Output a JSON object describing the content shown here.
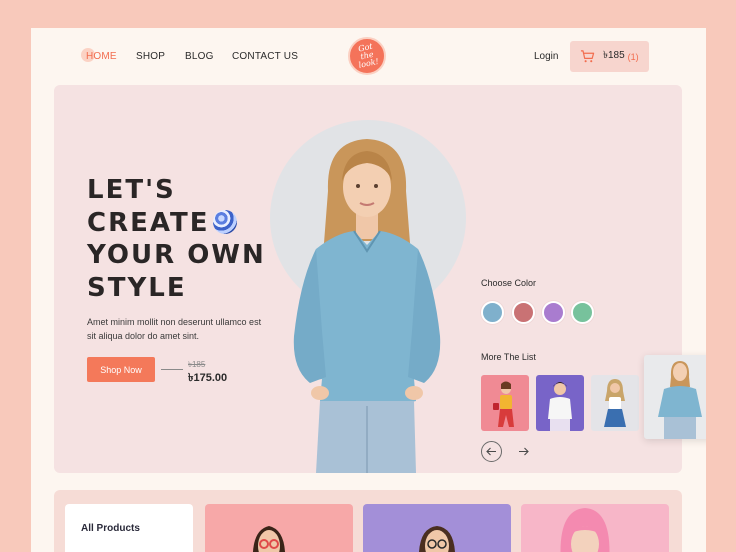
{
  "nav": {
    "home": "HOME",
    "shop": "SHOP",
    "blog": "BLOG",
    "contact": "CONTACT US",
    "logo_text": [
      "Got",
      "the",
      "look!"
    ],
    "login": "Login",
    "cart_amount": "৳185",
    "cart_count": "(1)"
  },
  "hero": {
    "headline": [
      "LET'S",
      "CREATE",
      "YOUR OWN",
      "STYLE"
    ],
    "description": "Amet minim mollit non deserunt ullamco est sit aliqua dolor do amet sint.",
    "cta": "Shop Now",
    "old_price": "৳185",
    "new_price": "৳175.00"
  },
  "options": {
    "choose_color_label": "Choose Color",
    "colors": [
      "#7fb0cc",
      "#c97274",
      "#a97ccf",
      "#77c29c"
    ],
    "more_list_label": "More The List",
    "thumbs": [
      "red-outfit",
      "white-top",
      "denim-skirt"
    ]
  },
  "bottom": {
    "all_products": "All Products"
  },
  "theme": {
    "accent": "#f4795a",
    "page_bg": "#f8c9bb",
    "hero_bg": "#f5e2e2"
  }
}
